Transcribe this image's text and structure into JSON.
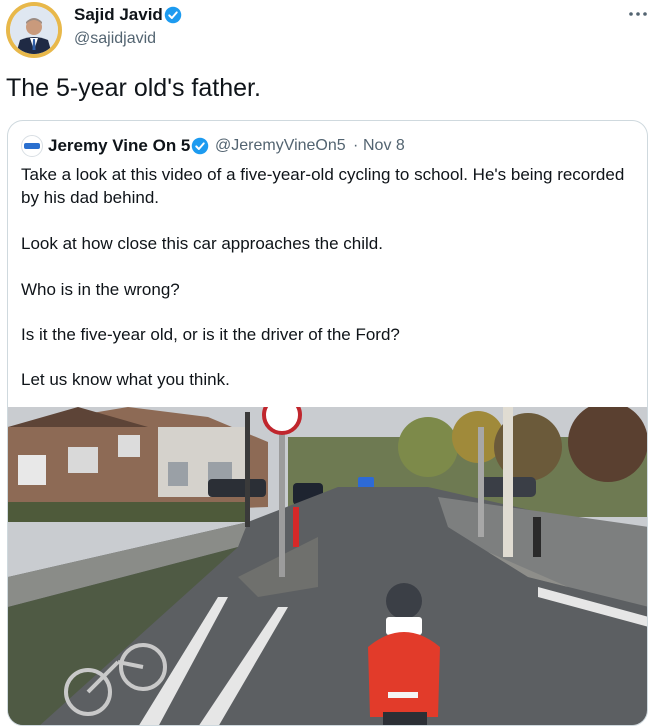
{
  "tweet": {
    "author_name": "Sajid Javid",
    "author_handle": "@sajidjavid",
    "text": "The 5-year old's father.",
    "more_icon": "ellipsis-icon"
  },
  "quote": {
    "author_name": "Jeremy Vine On 5",
    "author_handle": "@JeremyVineOn5",
    "separator": "·",
    "date": "Nov 8",
    "paragraphs": [
      "Take a look at this video of a five-year-old cycling to school. He's being recorded by his dad behind.",
      "Look at how close this car approaches the child.",
      "Who is in the wrong?",
      "Is it the five-year old, or is it the driver of the Ford?",
      "Let us know what you think."
    ]
  },
  "colors": {
    "verified": "#1d9bf0",
    "secondary_text": "#536471",
    "border": "#cfd9de"
  }
}
